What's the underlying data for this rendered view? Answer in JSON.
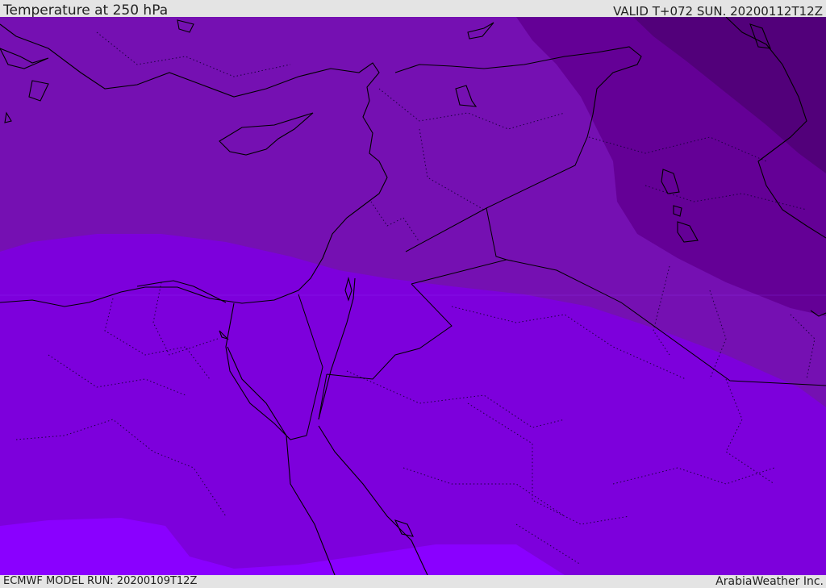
{
  "header": {
    "title": "Temperature at 250 hPa",
    "valid": "VALID T+072 SUN. 20200112T12Z"
  },
  "footer": {
    "model_run": "ECMWF MODEL RUN: 20200109T12Z",
    "credit": "ArabiaWeather Inc."
  },
  "colors": {
    "band_coldest": "#52007a",
    "band_colder": "#640096",
    "band_cold": "#7510b2",
    "band_mid": "#7d00dc",
    "band_warm": "#8a00ff",
    "coastline": "#000000",
    "borders": "#2a0050"
  }
}
